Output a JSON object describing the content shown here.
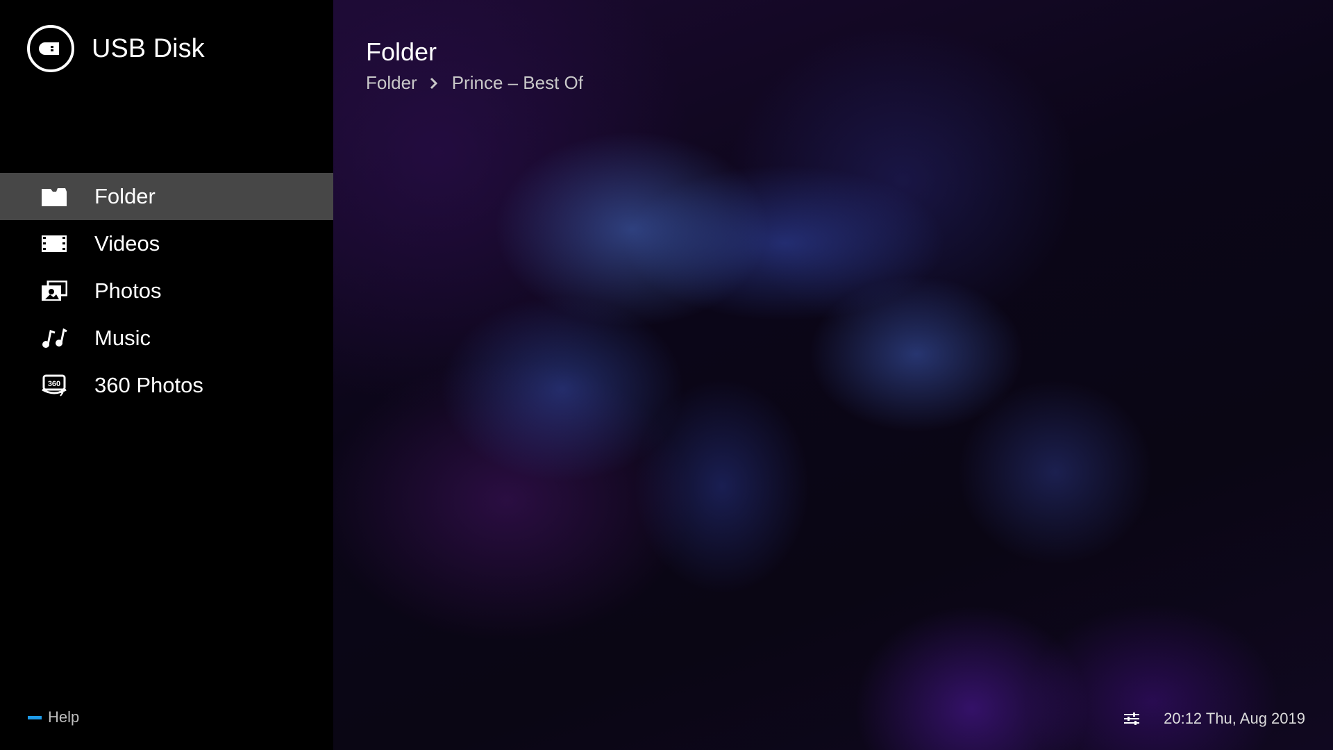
{
  "source": {
    "title": "USB Disk",
    "icon": "usb-drive-icon"
  },
  "sidebar": {
    "items": [
      {
        "label": "Folder",
        "icon": "folder-icon",
        "active": true
      },
      {
        "label": "Videos",
        "icon": "film-icon",
        "active": false
      },
      {
        "label": "Photos",
        "icon": "photos-icon",
        "active": false
      },
      {
        "label": "Music",
        "icon": "music-notes-icon",
        "active": false
      },
      {
        "label": "360 Photos",
        "icon": "photo-360-icon",
        "active": false
      }
    ],
    "active_background": "#474747"
  },
  "help": {
    "label": "Help",
    "key_color": "#1e9be9"
  },
  "main": {
    "title": "Folder",
    "breadcrumb": [
      "Folder",
      "Prince – Best Of"
    ]
  },
  "status": {
    "datetime": "20:12 Thu, Aug 2019",
    "settings_icon": "settings-sliders-icon"
  }
}
